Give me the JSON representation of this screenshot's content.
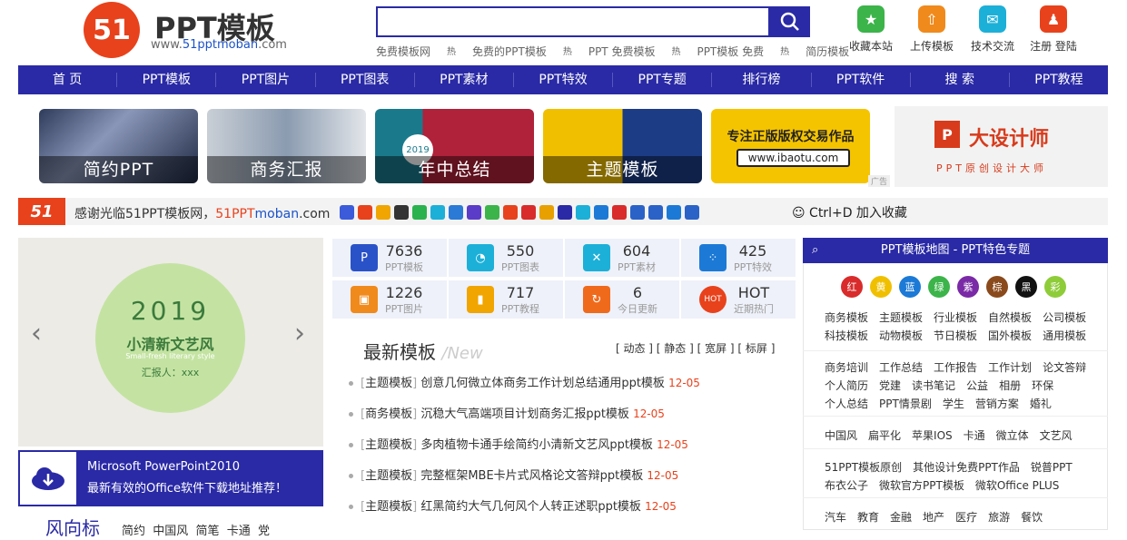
{
  "header": {
    "logo_mark": "51",
    "logo_title": "PPT模板",
    "logo_url_prefix": "www.",
    "logo_url_brand": "51pptmoban",
    "logo_url_suffix": ".com",
    "search_value": "",
    "hot_links": [
      "免费模板网",
      "免费的PPT模板",
      "PPT 免费模板",
      "PPT模板 免费",
      "简历模板"
    ],
    "hot_badge": "热",
    "top_icons": [
      {
        "label": "收藏本站",
        "icon": "star-icon",
        "color": "#3cb44a"
      },
      {
        "label": "上传模板",
        "icon": "upload-cloud-icon",
        "color": "#f08a1c"
      },
      {
        "label": "技术交流",
        "icon": "chat-icon",
        "color": "#1cb0d8"
      },
      {
        "label": "注册 登陆",
        "icon": "user-icon",
        "color": "#e8421c"
      }
    ]
  },
  "nav": [
    "首 页",
    "PPT模板",
    "PPT图片",
    "PPT图表",
    "PPT素材",
    "PPT特效",
    "PPT专题",
    "排行榜",
    "PPT软件",
    "搜 索",
    "PPT教程"
  ],
  "banners": [
    {
      "caption": "简约PPT",
      "color": "#3a4a6e"
    },
    {
      "caption": "商务汇报",
      "color": "#9aa6b2"
    },
    {
      "caption": "年中总结",
      "color": "#b0213a"
    },
    {
      "caption": "主题模板",
      "color": "#1d3c86"
    }
  ],
  "ad": {
    "line1": "专注正版版权交易作品",
    "line2": "www.ibaotu.com",
    "tag": "广告",
    "side_title": "大设计师",
    "side_sub": "PPT原创设计大师"
  },
  "welcome": {
    "logo": "51",
    "text_prefix": "感谢光临51PPT模板网，",
    "url_a": "51PPT",
    "url_b": "moban",
    "url_c": ".com",
    "shortcut": "Ctrl+D 加入收藏"
  },
  "share_colors": [
    "#3b5bdb",
    "#e8421c",
    "#f0a500",
    "#333",
    "#2ab24e",
    "#1cb0d8",
    "#2a7ad6",
    "#5a3cc8",
    "#3cb44a",
    "#e8421c",
    "#d92b2b",
    "#e8a000",
    "#2a2aa6",
    "#1cb0d8",
    "#1c7ad6",
    "#d92b2b",
    "#2a62c8",
    "#2a62c8",
    "#1c7ad6",
    "#2a62c8"
  ],
  "slider": {
    "year": "2019",
    "title": "小清新文艺风",
    "subtitle": "Small-fresh literary style",
    "reporter": "汇报人：xxx"
  },
  "download": {
    "title": "Microsoft PowerPoint2010",
    "desc": "最新有效的Office软件下载地址推荐！"
  },
  "bottom_left": {
    "title": "风向标",
    "tags": "简约  中国风  简笔  卡通  党"
  },
  "stats": [
    {
      "num": "7636",
      "label": "PPT模板",
      "icon": "ppt-icon",
      "color": "#2a52c8"
    },
    {
      "num": "550",
      "label": "PPT图表",
      "icon": "pie-chart-icon",
      "color": "#1cb0d8"
    },
    {
      "num": "604",
      "label": "PPT素材",
      "icon": "tools-icon",
      "color": "#1cb0d8"
    },
    {
      "num": "425",
      "label": "PPT特效",
      "icon": "spinner-icon",
      "color": "#1c7ad6"
    },
    {
      "num": "1226",
      "label": "PPT图片",
      "icon": "image-icon",
      "color": "#f08a1c"
    },
    {
      "num": "717",
      "label": "PPT教程",
      "icon": "book-icon",
      "color": "#f0a500"
    },
    {
      "num": "6",
      "label": "今日更新",
      "icon": "refresh-icon",
      "color": "#f06a1c"
    },
    {
      "num": "HOT",
      "label": "近期热门",
      "icon": "hot-icon",
      "color": "#e8421c"
    }
  ],
  "latest": {
    "title": "最新模板",
    "title_en": "New",
    "filter": "[ 动态 ] [ 静态 ] [ 宽屏 ] [ 标屏 ]",
    "items": [
      {
        "cat": "主题模板",
        "title": "创意几何微立体商务工作计划总结通用ppt模板",
        "date": "12-05"
      },
      {
        "cat": "商务模板",
        "title": "沉稳大气高端项目计划商务汇报ppt模板",
        "date": "12-05"
      },
      {
        "cat": "主题模板",
        "title": "多肉植物卡通手绘简约小清新文艺风ppt模板",
        "date": "12-05"
      },
      {
        "cat": "主题模板",
        "title": "完整框架MBE卡片式风格论文答辩ppt模板",
        "date": "12-05"
      },
      {
        "cat": "主题模板",
        "title": "红黑简约大气几何风个人转正述职ppt模板",
        "date": "12-05"
      }
    ]
  },
  "right_panel": {
    "title": "PPT模板地图 - PPT特色专题",
    "colors": [
      {
        "label": "红",
        "color": "#d92b2b"
      },
      {
        "label": "黄",
        "color": "#f0c000"
      },
      {
        "label": "蓝",
        "color": "#1c7ad6"
      },
      {
        "label": "绿",
        "color": "#3cb44a"
      },
      {
        "label": "紫",
        "color": "#7a2aa6"
      },
      {
        "label": "棕",
        "color": "#8a4a1c"
      },
      {
        "label": "黑",
        "color": "#111111"
      },
      {
        "label": "彩",
        "color": "#8fcc3a"
      }
    ],
    "rows": [
      [
        "商务模板",
        "主题模板",
        "行业模板",
        "自然模板",
        "公司模板"
      ],
      [
        "科技模板",
        "动物模板",
        "节日模板",
        "国外模板",
        "通用模板"
      ],
      [
        "商务培训",
        "工作总结",
        "工作报告",
        "工作计划",
        "论文答辩"
      ],
      [
        "个人简历",
        "党建",
        "读书笔记",
        "公益",
        "相册",
        "环保"
      ],
      [
        "个人总结",
        "PPT情景剧",
        "学生",
        "营销方案",
        "婚礼"
      ],
      [
        "中国风",
        "扁平化",
        "苹果IOS",
        "卡通",
        "微立体",
        "文艺风"
      ],
      [
        "51PPT模板原创",
        "其他设计免费PPT作品",
        "锐普PPT"
      ],
      [
        "布衣公子",
        "微软官方PPT模板",
        "微软Office PLUS"
      ],
      [
        "汽车",
        "教育",
        "金融",
        "地产",
        "医疗",
        "旅游",
        "餐饮"
      ]
    ]
  }
}
